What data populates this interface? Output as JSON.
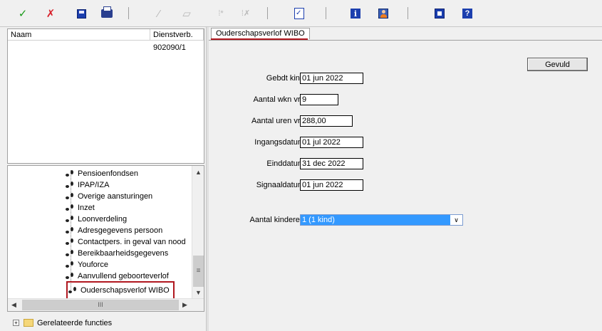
{
  "toolbar": {
    "ok_glyph": "✓",
    "cancel_glyph": "✗",
    "edit1_glyph": "⁄",
    "edit2_glyph": "▱",
    "mark1_glyph": "⁞*",
    "mark2_glyph": "⁞✗",
    "info_glyph": "i",
    "help_glyph": "?"
  },
  "left_top": {
    "headers": [
      "Naam",
      "Dienstverb."
    ],
    "rows": [
      {
        "naam": "",
        "dienstverb": "902090/1"
      }
    ]
  },
  "tree": {
    "items": [
      "Pensioenfondsen",
      "IPAP/IZA",
      "Overige aansturingen",
      "Inzet",
      "Loonverdeling",
      "Adresgegevens persoon",
      "Contactpers. in geval van nood",
      "Bereikbaarheidsgegevens",
      "Youforce",
      "Aanvullend geboorteverlof",
      "Ouderschapsverlof WIBO"
    ],
    "hscroll_mark": "III",
    "scroll_up": "▲",
    "scroll_down": "▼",
    "scroll_left": "◀",
    "scroll_right": "▶",
    "scroll_grip": "≡"
  },
  "related": {
    "expander": "+",
    "label": "Gerelateerde functies"
  },
  "right": {
    "tab_label": "Ouderschapsverlof WIBO",
    "gevuld_label": "Gevuld",
    "fields": [
      {
        "label": "Gebdt kind",
        "value": "01 jun 2022"
      },
      {
        "label": "Aantal wkn vrlf",
        "value": "9"
      },
      {
        "label": "Aantal uren vrlf",
        "value": "288,00"
      },
      {
        "label": "Ingangsdatum",
        "value": "01 jul 2022"
      },
      {
        "label": "Einddatum",
        "value": "31 dec 2022"
      },
      {
        "label": "Signaaldatum",
        "value": "01 jun 2022"
      }
    ],
    "kinderen_label": "Aantal kinderen",
    "kinderen_value": "1 (1 kind)",
    "dropdown_glyph": "∨"
  },
  "colors": {
    "ok": "#1a9b1a",
    "cancel": "#d8202a",
    "highlight": "#b0171f",
    "selection": "#3399ff"
  }
}
